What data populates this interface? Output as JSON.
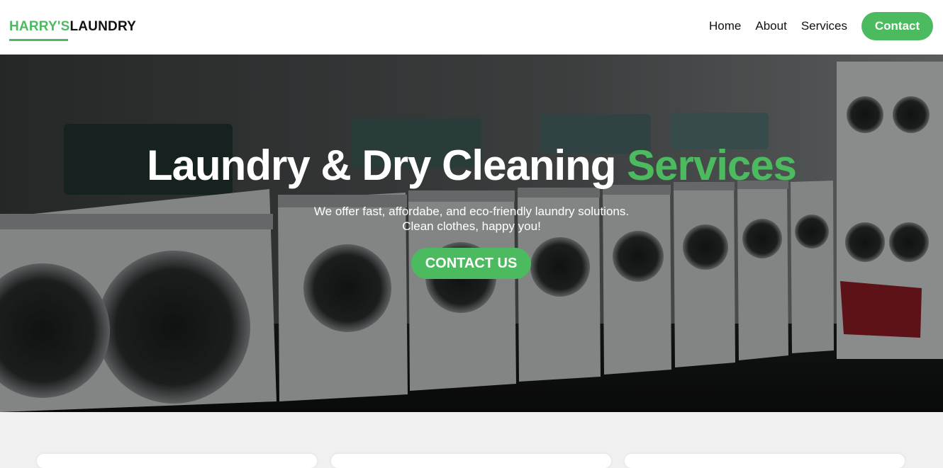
{
  "brand": {
    "part1": "HARRY'S",
    "part2": "LAUNDRY"
  },
  "nav": {
    "items": [
      "Home",
      "About",
      "Services"
    ],
    "contact_label": "Contact"
  },
  "hero": {
    "title_main": "Laundry & Dry Cleaning ",
    "title_accent": "Services",
    "subtitle_line1": "We offer fast, affordabe, and eco-friendly laundry solutions.",
    "subtitle_line2": "Clean clothes, happy you!",
    "cta_label": "CONTACT US"
  },
  "colors": {
    "accent": "#4cbb5f",
    "text_dark": "#111111",
    "section_bg": "#f0f0f0"
  }
}
